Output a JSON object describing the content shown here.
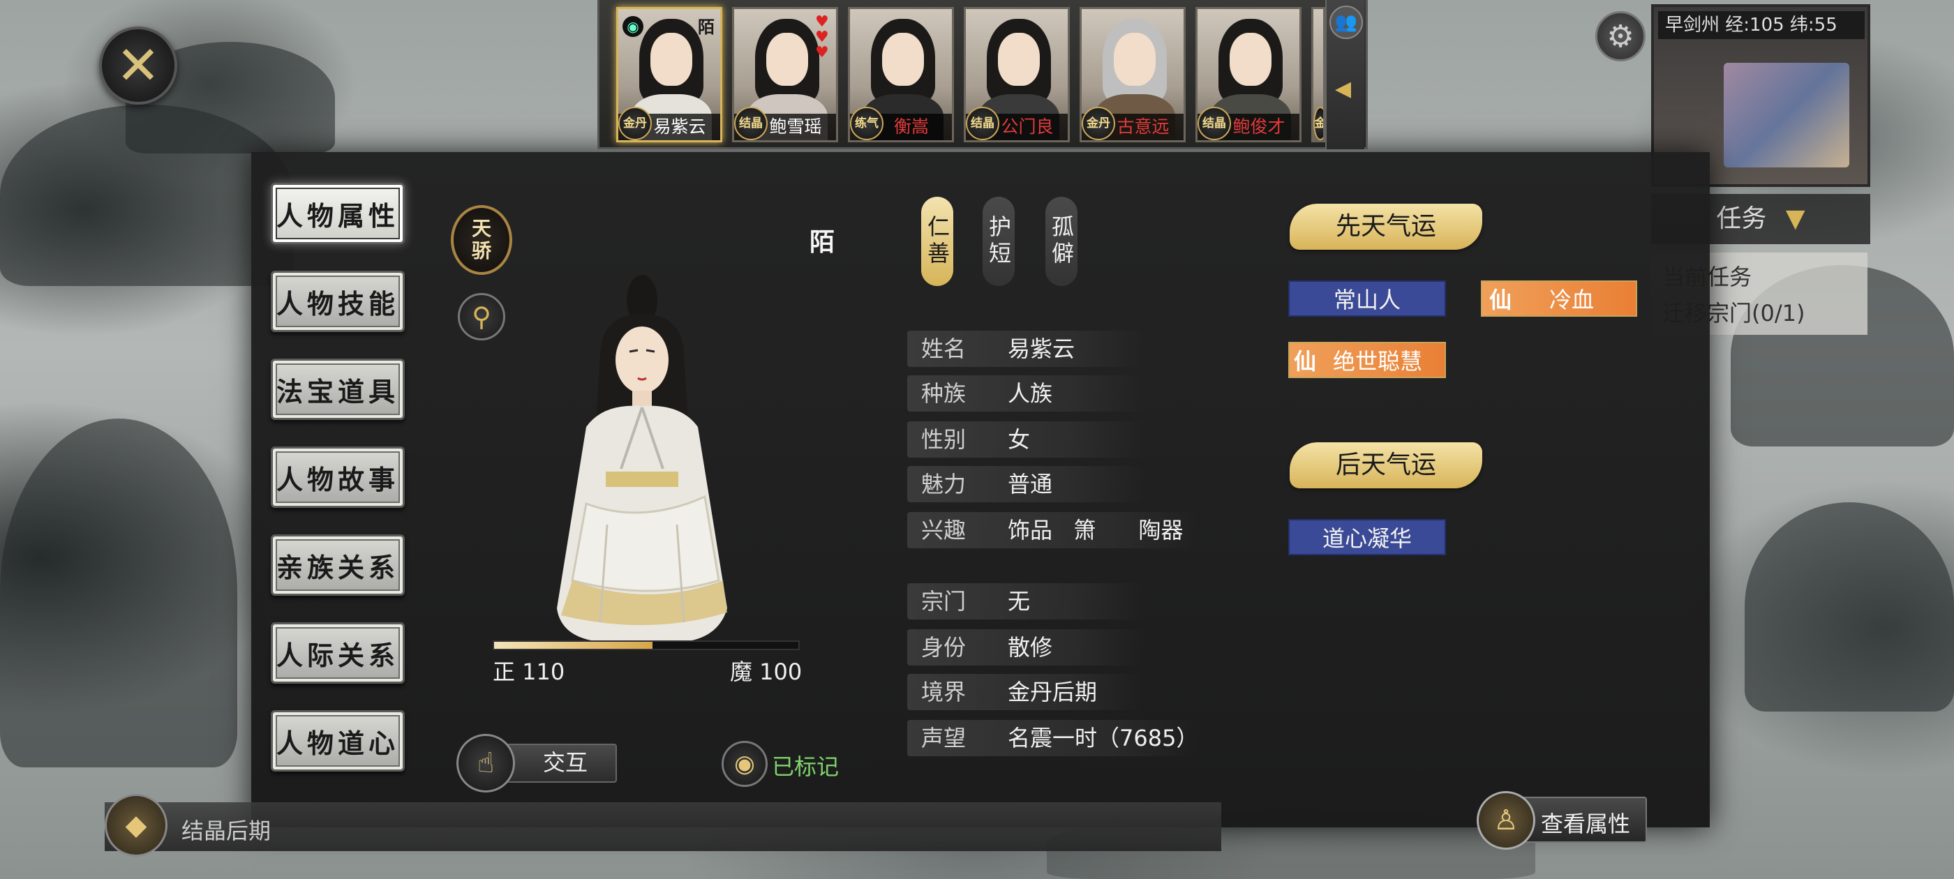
{
  "roster": {
    "characters": [
      {
        "name": "易紫云",
        "rank": "金丹",
        "mark": "陌",
        "selected": true
      },
      {
        "name": "鲍雪瑶",
        "rank": "结晶",
        "mark": "",
        "hearts": 3
      },
      {
        "name": "衡嵩",
        "rank": "练气",
        "mark": ""
      },
      {
        "name": "公门良",
        "rank": "结晶",
        "mark": ""
      },
      {
        "name": "古意远",
        "rank": "金丹",
        "mark": ""
      },
      {
        "name": "鲍俊才",
        "rank": "结晶",
        "mark": ""
      },
      {
        "name": "",
        "rank": "金",
        "mark": ""
      }
    ]
  },
  "menu": [
    {
      "label": "人物属性",
      "active": true
    },
    {
      "label": "人物技能"
    },
    {
      "label": "法宝道具"
    },
    {
      "label": "人物故事"
    },
    {
      "label": "亲族关系"
    },
    {
      "label": "人际关系"
    },
    {
      "label": "人物道心"
    }
  ],
  "badge": {
    "label": "天骄"
  },
  "relation_mark": "陌",
  "traits": [
    "仁善",
    "护短",
    "孤僻"
  ],
  "moral": {
    "zheng_label": "正 110",
    "mo_label": "魔 100",
    "zheng_fraction": 0.52
  },
  "info": [
    {
      "label": "姓名",
      "value": "易紫云"
    },
    {
      "label": "种族",
      "value": "人族"
    },
    {
      "label": "性别",
      "value": "女"
    },
    {
      "label": "魅力",
      "value": "普通"
    },
    {
      "label": "兴趣",
      "value": "饰品   箫      陶器"
    },
    {
      "label": "宗门",
      "value": "无"
    },
    {
      "label": "身份",
      "value": "散修"
    },
    {
      "label": "境界",
      "value": "金丹后期"
    },
    {
      "label": "声望",
      "value": "名震一时（7685）"
    }
  ],
  "innate": {
    "title": "先天气运",
    "items": [
      {
        "label": "常山人",
        "style": "blue"
      },
      {
        "label": "冷血",
        "style": "orange",
        "prefix": "仙"
      },
      {
        "label": "绝世聪慧",
        "style": "orange",
        "prefix": "仙"
      }
    ]
  },
  "acquired": {
    "title": "后天气运",
    "items": [
      {
        "label": "道心凝华",
        "style": "blue"
      }
    ]
  },
  "buttons": {
    "interact": "交互",
    "marked": "已标记",
    "view_attributes": "查看属性"
  },
  "top_right": {
    "time_text": "早剑州 经:105 纬:55",
    "task_label": "任务",
    "task_title": "当前任务",
    "task_item": "迁移宗门(0/1)"
  },
  "bottom_bar": {
    "crystal_label": "结晶后期"
  },
  "colors": {
    "gold": "#d8b459",
    "blue_tag": "#3b4a96",
    "orange_tag": "#e97f35",
    "panel": "#1e1e1e"
  },
  "icons": [
    "close-icon",
    "search-icon",
    "eye-icon",
    "hand-icon",
    "gear-icon",
    "people-icon",
    "arrow-left-icon"
  ]
}
